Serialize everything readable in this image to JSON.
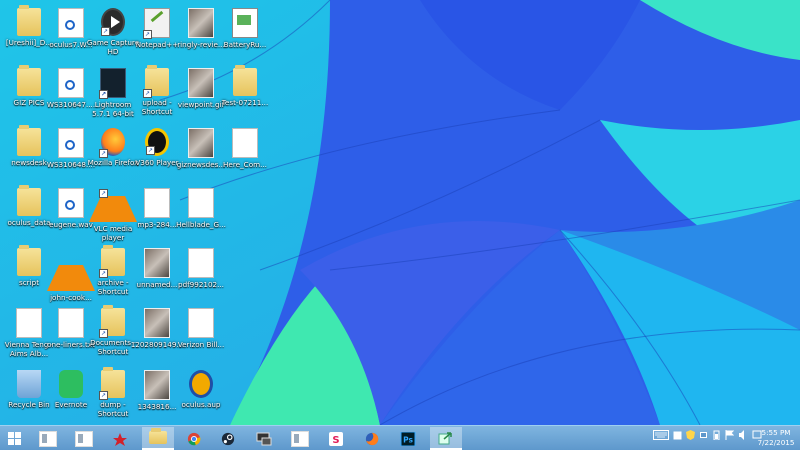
{
  "colors": {
    "taskbar": "#6aa5d6",
    "wallpaper_blue": "#2e5ee8",
    "wallpaper_cyan": "#2ad0e0",
    "wallpaper_green": "#40e8b0"
  },
  "desktop": {
    "col1": [
      {
        "label": "[Ureshii]_D...",
        "icon": "folder-icon"
      },
      {
        "label": "GIZ PICS",
        "icon": "folder-icon"
      },
      {
        "label": "newsdesk",
        "icon": "folder-icon"
      },
      {
        "label": "oculus_data",
        "icon": "folder-icon"
      },
      {
        "label": "script",
        "icon": "folder-icon"
      },
      {
        "label": "Vienna Teng - Aims Alb...",
        "icon": "document-icon"
      },
      {
        "label": "Recycle Bin",
        "icon": "recycle-bin-icon"
      }
    ],
    "col2": [
      {
        "label": "oculus7.W...",
        "icon": "wma-file-icon"
      },
      {
        "label": "WS310647....",
        "icon": "wma-file-icon"
      },
      {
        "label": "WS310648....",
        "icon": "wma-file-icon"
      },
      {
        "label": "eugene.wav",
        "icon": "wav-file-icon"
      },
      {
        "label": "john-cook...",
        "icon": "vlc-file-icon"
      },
      {
        "label": "one-liners.txt",
        "icon": "text-file-icon"
      },
      {
        "label": "Evernote",
        "icon": "evernote-icon"
      }
    ],
    "col3": [
      {
        "label": "Game Capture HD",
        "icon": "game-capture-icon"
      },
      {
        "label": "Lightroom 5.7.1 64-bit",
        "icon": "lightroom-icon"
      },
      {
        "label": "Mozilla Firefox",
        "icon": "firefox-icon"
      },
      {
        "label": "VLC media player",
        "icon": "vlc-icon"
      },
      {
        "label": "archive - Shortcut",
        "icon": "folder-shortcut-icon"
      },
      {
        "label": "Documents - Shortcut",
        "icon": "folder-shortcut-icon"
      },
      {
        "label": "dump - Shortcut",
        "icon": "folder-shortcut-icon"
      }
    ],
    "col4": [
      {
        "label": "Notepad++",
        "icon": "notepad-plus-icon"
      },
      {
        "label": "upload - Shortcut",
        "icon": "folder-shortcut-icon"
      },
      {
        "label": "V360 Player",
        "icon": "v360-player-icon"
      },
      {
        "label": "mp3-284...",
        "icon": "mp3-file-icon"
      },
      {
        "label": "unnamed...",
        "icon": "image-file-icon"
      },
      {
        "label": "1202809149...",
        "icon": "image-file-icon"
      },
      {
        "label": "1343816...",
        "icon": "image-file-icon"
      }
    ],
    "col5": [
      {
        "label": "ringly-revie...",
        "icon": "image-file-icon"
      },
      {
        "label": "viewpoint.gif",
        "icon": "image-file-icon"
      },
      {
        "label": "giznewsdes...",
        "icon": "image-file-icon"
      },
      {
        "label": "Hellblade_G...",
        "icon": "pdf-file-icon"
      },
      {
        "label": "pdf992102...",
        "icon": "pdf-file-icon"
      },
      {
        "label": "Verizon Bill...",
        "icon": "pdf-file-icon"
      },
      {
        "label": "oculus.aup",
        "icon": "audacity-icon"
      }
    ],
    "col6": [
      {
        "label": "BatteryRu...",
        "icon": "battery-report-icon"
      },
      {
        "label": "Test-07211...",
        "icon": "folder-icon"
      },
      {
        "label": "Here_Com...",
        "icon": "document-icon"
      }
    ]
  },
  "taskbar": {
    "apps": [
      {
        "name": "start-button",
        "icon": "windows-logo-icon"
      },
      {
        "name": "task-view",
        "icon": "window-icon"
      },
      {
        "name": "task-app-2",
        "icon": "window-icon"
      },
      {
        "name": "task-app-3",
        "icon": "paint-icon"
      },
      {
        "name": "file-explorer",
        "icon": "folder-icon"
      },
      {
        "name": "chrome",
        "icon": "chrome-icon"
      },
      {
        "name": "steam",
        "icon": "steam-icon"
      },
      {
        "name": "remote-desktop",
        "icon": "remote-desktop-icon"
      },
      {
        "name": "window-app",
        "icon": "window-icon"
      },
      {
        "name": "slack",
        "icon": "slack-icon"
      },
      {
        "name": "firefox",
        "icon": "firefox-icon"
      },
      {
        "name": "photoshop",
        "icon": "photoshop-icon"
      },
      {
        "name": "sharing-app",
        "icon": "share-icon"
      }
    ],
    "tray_icons": [
      "keyboard-icon",
      "window-icon",
      "security-icon",
      "network-icon",
      "battery-icon",
      "flag-icon",
      "speaker-icon",
      "notification-icon"
    ],
    "clock_time": "5:55 PM",
    "clock_date": "7/22/2015"
  }
}
